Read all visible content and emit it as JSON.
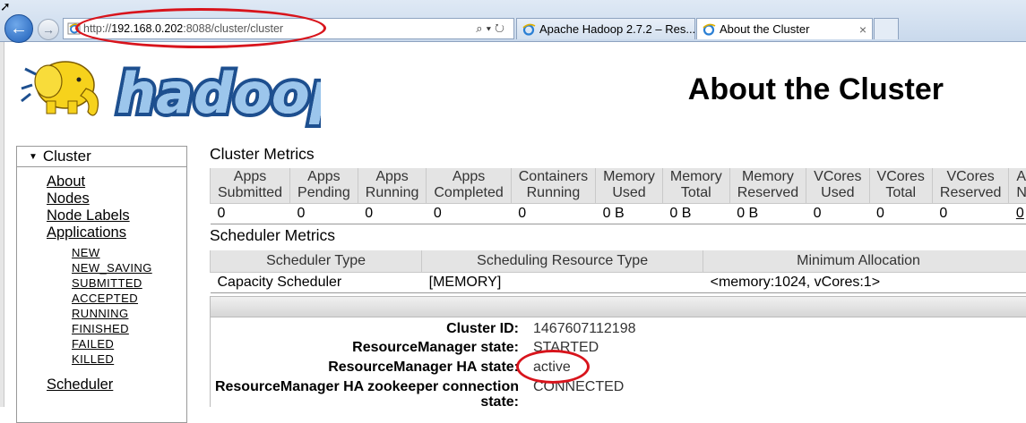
{
  "browser": {
    "url_prefix": "http://",
    "url_host": "192.168.0.202",
    "url_rest": ":8088/cluster/cluster",
    "toolbar_glyphs": "⌕▾↻",
    "tabs": [
      {
        "title": "Apache Hadoop 2.7.2 – Res..."
      },
      {
        "title": "About the Cluster",
        "close": "×"
      }
    ]
  },
  "page": {
    "logo_text": "hadoop",
    "title": "About the Cluster"
  },
  "sidebar": {
    "cluster_heading": "Cluster",
    "links": [
      "About",
      "Nodes",
      "Node Labels",
      "Applications"
    ],
    "app_states": [
      "NEW",
      "NEW_SAVING",
      "SUBMITTED",
      "ACCEPTED",
      "RUNNING",
      "FINISHED",
      "FAILED",
      "KILLED"
    ],
    "scheduler_link": "Scheduler"
  },
  "cluster_metrics": {
    "title": "Cluster Metrics",
    "headers": [
      [
        "Apps",
        "Submitted"
      ],
      [
        "Apps",
        "Pending"
      ],
      [
        "Apps",
        "Running"
      ],
      [
        "Apps",
        "Completed"
      ],
      [
        "Containers",
        "Running"
      ],
      [
        "Memory",
        "Used"
      ],
      [
        "Memory",
        "Total"
      ],
      [
        "Memory",
        "Reserved"
      ],
      [
        "VCores",
        "Used"
      ],
      [
        "VCores",
        "Total"
      ],
      [
        "VCores",
        "Reserved"
      ],
      [
        "Ac",
        "No"
      ]
    ],
    "values": [
      "0",
      "0",
      "0",
      "0",
      "0",
      "0 B",
      "0 B",
      "0 B",
      "0",
      "0",
      "0",
      "0"
    ]
  },
  "scheduler_metrics": {
    "title": "Scheduler Metrics",
    "headers": [
      "Scheduler Type",
      "Scheduling Resource Type",
      "Minimum Allocation"
    ],
    "values": [
      "Capacity Scheduler",
      "[MEMORY]",
      "<memory:1024, vCores:1>"
    ]
  },
  "cluster_info": {
    "cluster_id_label": "Cluster ID:",
    "cluster_id": "1467607112198",
    "rm_state_label": "ResourceManager state:",
    "rm_state": "STARTED",
    "rm_ha_state_label": "ResourceManager HA state:",
    "rm_ha_state": "active",
    "zk_label_line1": "ResourceManager HA zookeeper connection",
    "zk_label_line2": "state:",
    "zk_state": "CONNECTED"
  },
  "colors": {
    "annotation_ring": "#d8141c",
    "header_bg": "#e4e4e4",
    "logo_blue": "#1d4f8f",
    "logo_yellow": "#f6d21c"
  }
}
